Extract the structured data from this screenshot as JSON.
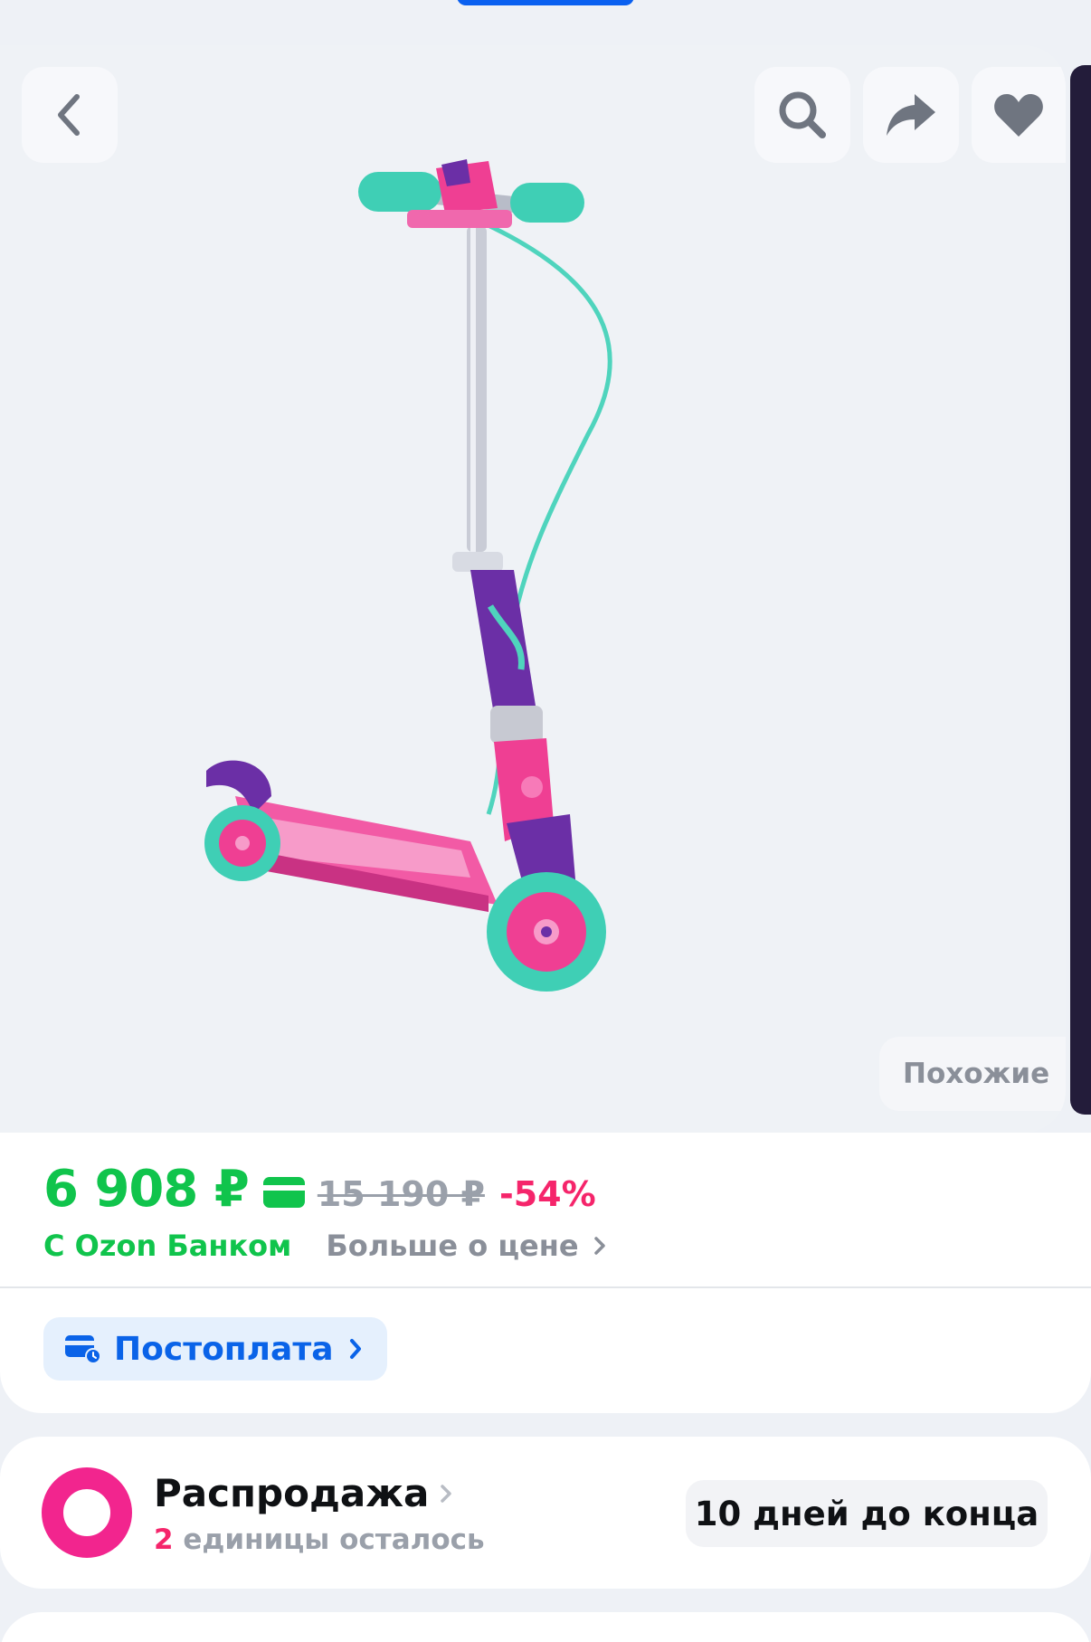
{
  "gallery": {
    "similar_label": "Похожие"
  },
  "price": {
    "current": "6 908 ₽",
    "old": "15 190 ₽",
    "discount": "-54%",
    "bank_label": "С Ozon Банком",
    "more_label": "Больше о цене"
  },
  "postpay": {
    "label": "Постоплата"
  },
  "sale": {
    "title": "Распродажа",
    "count": "2",
    "units_left": "единицы осталось",
    "days_left": "10 дней до конца"
  },
  "icons": {
    "back": "chevron-left-icon",
    "search": "search-icon",
    "share": "share-icon",
    "favorite": "heart-icon",
    "card": "credit-card-icon",
    "postpay": "card-clock-icon"
  },
  "colors": {
    "price_green": "#10c44c",
    "discount_pink": "#f5256b",
    "link_blue": "#0a63e8",
    "brand_blue": "#0a60f0"
  }
}
